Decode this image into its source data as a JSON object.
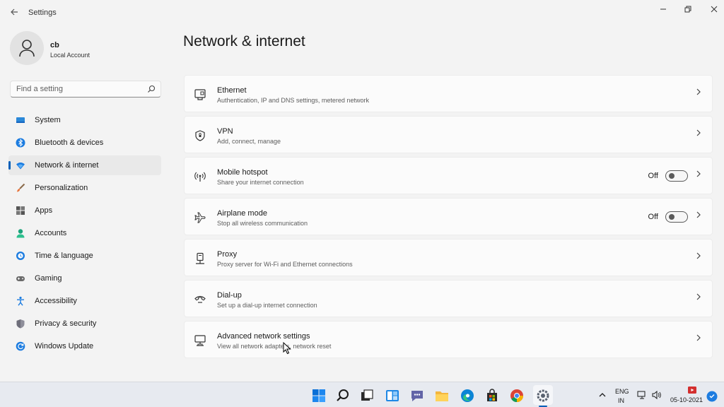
{
  "window": {
    "title": "Settings",
    "back_icon": "back-arrow-icon",
    "controls": [
      "minimize-icon",
      "restore-icon",
      "close-icon"
    ]
  },
  "profile": {
    "name": "cb",
    "account_type": "Local Account",
    "avatar_icon": "person-icon"
  },
  "search": {
    "placeholder": "Find a setting",
    "icon": "search-icon"
  },
  "sidebar": {
    "items": [
      {
        "label": "System",
        "icon": "monitor-icon",
        "active": false
      },
      {
        "label": "Bluetooth & devices",
        "icon": "bluetooth-icon",
        "active": false
      },
      {
        "label": "Network & internet",
        "icon": "wifi-icon",
        "active": true
      },
      {
        "label": "Personalization",
        "icon": "brush-icon",
        "active": false
      },
      {
        "label": "Apps",
        "icon": "apps-icon",
        "active": false
      },
      {
        "label": "Accounts",
        "icon": "accounts-icon",
        "active": false
      },
      {
        "label": "Time & language",
        "icon": "clock-globe-icon",
        "active": false
      },
      {
        "label": "Gaming",
        "icon": "gamepad-icon",
        "active": false
      },
      {
        "label": "Accessibility",
        "icon": "accessibility-icon",
        "active": false
      },
      {
        "label": "Privacy & security",
        "icon": "shield-icon",
        "active": false
      },
      {
        "label": "Windows Update",
        "icon": "update-icon",
        "active": false
      }
    ]
  },
  "main": {
    "title": "Network & internet",
    "cards": [
      {
        "title": "Ethernet",
        "subtitle": "Authentication, IP and DNS settings, metered network",
        "icon": "ethernet-icon"
      },
      {
        "title": "VPN",
        "subtitle": "Add, connect, manage",
        "icon": "vpn-shield-icon"
      },
      {
        "title": "Mobile hotspot",
        "subtitle": "Share your internet connection",
        "icon": "hotspot-icon",
        "toggle": "Off"
      },
      {
        "title": "Airplane mode",
        "subtitle": "Stop all wireless communication",
        "icon": "airplane-icon",
        "toggle": "Off"
      },
      {
        "title": "Proxy",
        "subtitle": "Proxy server for Wi-Fi and Ethernet connections",
        "icon": "proxy-icon"
      },
      {
        "title": "Dial-up",
        "subtitle": "Set up a dial-up internet connection",
        "icon": "dialup-icon"
      },
      {
        "title": "Advanced network settings",
        "subtitle": "View all network adapters, network reset",
        "icon": "network-adapter-icon"
      }
    ]
  },
  "taskbar": {
    "apps": [
      "windows-start-icon",
      "search-icon",
      "task-view-icon",
      "widgets-icon",
      "teams-chat-icon",
      "file-explorer-icon",
      "edge-icon",
      "store-icon",
      "chrome-icon",
      "settings-icon"
    ],
    "language": "ENG",
    "region": "IN",
    "date": "05-10-2021"
  },
  "colors": {
    "accent": "#005fb8",
    "background": "#f3f3f3",
    "card": "#fbfbfb",
    "taskbar": "#e7eaf0"
  }
}
